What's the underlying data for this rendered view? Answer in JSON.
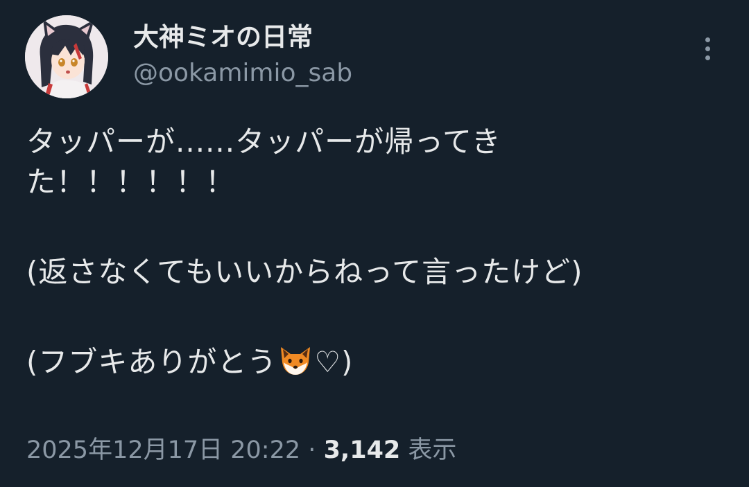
{
  "author": {
    "display_name": "大神ミオの日常",
    "handle": "@ookamimio_sab",
    "avatar_icon": "avatar-image"
  },
  "more_icon": "more-vertical-icon",
  "tweet": {
    "line1": "タッパーが......タッパーが帰ってき",
    "line2": "た！！！！！！",
    "line3": "(返さなくてもいいからねって言ったけど)",
    "line4_text": "(フブキありがとう",
    "line4_emoji": "fox-face-emoji",
    "line4_suffix": "♡)"
  },
  "meta": {
    "timestamp": "2025年12月17日 20:22",
    "separator": "·",
    "views_count": "3,142",
    "views_label": "表示"
  },
  "colors": {
    "background": "#15202b",
    "text_primary": "#e7e9ea",
    "text_secondary": "#8b98a5"
  }
}
